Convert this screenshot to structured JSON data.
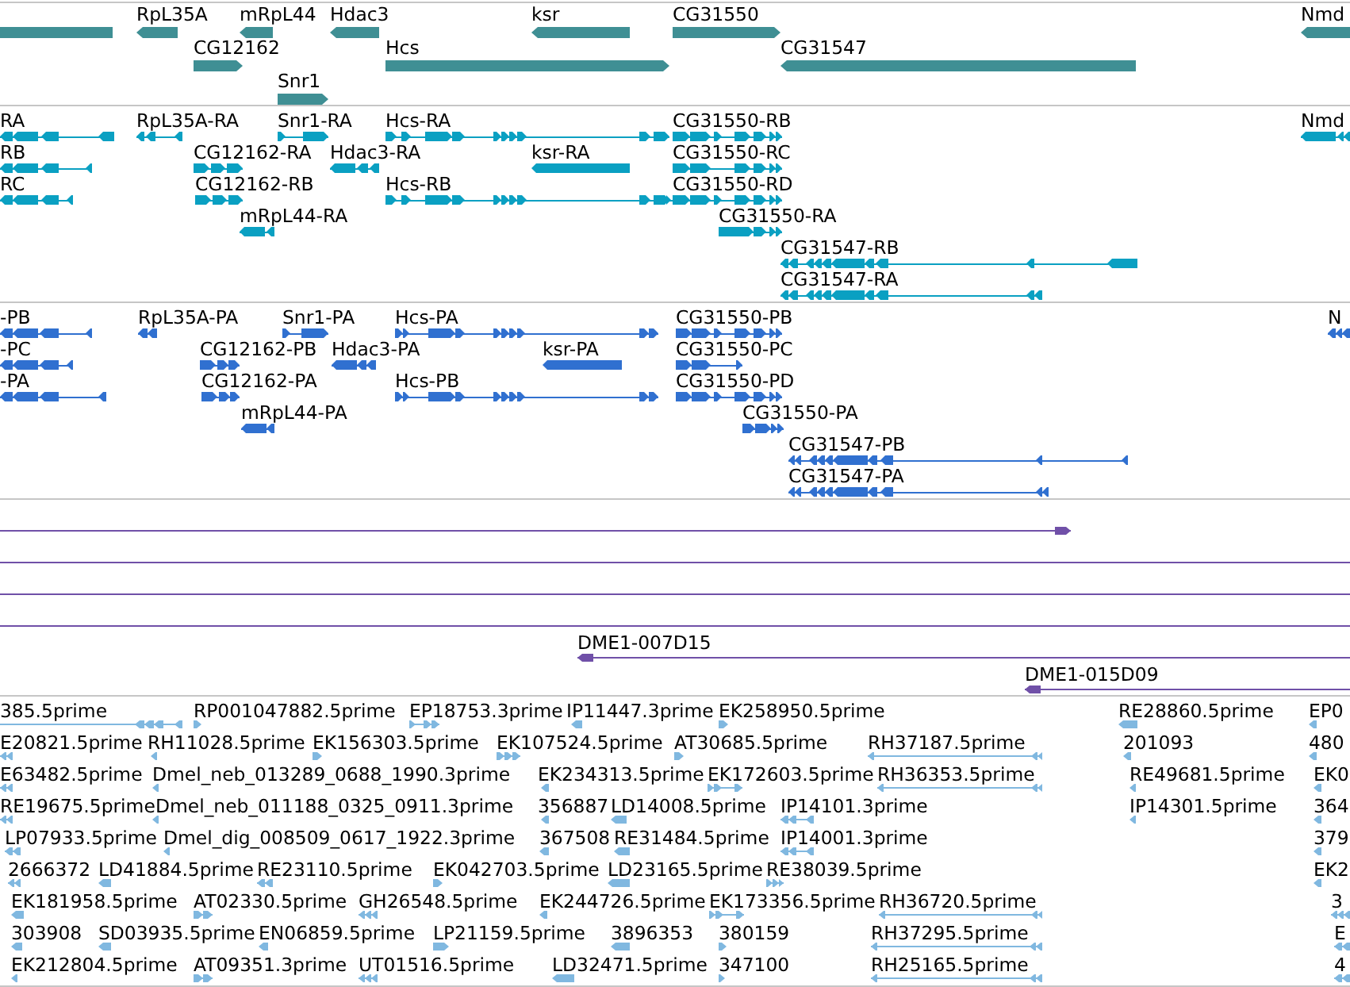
{
  "tracks": [
    {
      "kind": "gene",
      "features": [
        {
          "kind": "plain"
        },
        {
          "label": "RpL35A",
          "kind": "reverse"
        },
        {
          "label": "mRpL44",
          "kind": "reverse"
        },
        {
          "label": "Hdac3",
          "kind": "reverse"
        },
        {
          "label": "ksr",
          "kind": "reverse"
        },
        {
          "label": "CG31550",
          "kind": "forward"
        },
        {
          "label": "Nmd",
          "kind": "reverse"
        },
        {
          "label": "CG12162",
          "kind": "forward"
        },
        {
          "label": "Hcs",
          "kind": "forward"
        },
        {
          "label": "CG31547",
          "kind": "reverse"
        },
        {
          "label": "Snr1",
          "kind": "forward"
        }
      ]
    },
    {
      "kind": "transcript",
      "features": [
        {
          "label": "RA",
          "kind": "reverse"
        },
        {
          "label": "RpL35A-RA",
          "kind": "reverse"
        },
        {
          "label": "Snr1-RA",
          "kind": "forward"
        },
        {
          "label": "Hcs-RA",
          "kind": "forward"
        },
        {
          "label": "CG31550-RB",
          "kind": "forward"
        },
        {
          "label": "Nmd",
          "kind": "reverse"
        },
        {
          "label": "RB",
          "kind": "reverse"
        },
        {
          "label": "CG12162-RA",
          "kind": "forward"
        },
        {
          "label": "Hdac3-RA",
          "kind": "reverse"
        },
        {
          "label": "ksr-RA",
          "kind": "reverse"
        },
        {
          "label": "CG31550-RC",
          "kind": "forward"
        },
        {
          "label": "RC",
          "kind": "reverse"
        },
        {
          "label": "CG12162-RB",
          "kind": "forward"
        },
        {
          "label": "Hcs-RB",
          "kind": "forward"
        },
        {
          "label": "CG31550-RD",
          "kind": "forward"
        },
        {
          "label": "mRpL44-RA",
          "kind": "reverse"
        },
        {
          "label": "CG31550-RA",
          "kind": "forward"
        },
        {
          "label": "CG31547-RB",
          "kind": "reverse"
        },
        {
          "label": "CG31547-RA",
          "kind": "reverse"
        }
      ]
    },
    {
      "kind": "protein",
      "features": [
        {
          "label": "-PB",
          "kind": "reverse"
        },
        {
          "label": "RpL35A-PA",
          "kind": "reverse"
        },
        {
          "label": "Snr1-PA",
          "kind": "forward"
        },
        {
          "label": "Hcs-PA",
          "kind": "forward"
        },
        {
          "label": "CG31550-PB",
          "kind": "forward"
        },
        {
          "label": "N",
          "kind": "reverse"
        },
        {
          "label": "-PC",
          "kind": "reverse"
        },
        {
          "label": "CG12162-PB",
          "kind": "forward"
        },
        {
          "label": "Hdac3-PA",
          "kind": "reverse"
        },
        {
          "label": "ksr-PA",
          "kind": "reverse"
        },
        {
          "label": "CG31550-PC",
          "kind": "forward"
        },
        {
          "label": "-PA",
          "kind": "reverse"
        },
        {
          "label": "CG12162-PA",
          "kind": "forward"
        },
        {
          "label": "Hcs-PB",
          "kind": "forward"
        },
        {
          "label": "CG31550-PD",
          "kind": "forward"
        },
        {
          "label": "mRpL44-PA",
          "kind": "reverse"
        },
        {
          "label": "CG31550-PA",
          "kind": "forward"
        },
        {
          "label": "CG31547-PB",
          "kind": "reverse"
        },
        {
          "label": "CG31547-PA",
          "kind": "reverse"
        }
      ]
    },
    {
      "kind": "clone",
      "features": [
        {
          "kind": "forward"
        },
        {
          "kind": "plain"
        },
        {
          "kind": "plain"
        },
        {
          "kind": "plain"
        },
        {
          "label": "DME1-007D15",
          "kind": "reverse"
        },
        {
          "label": "DME1-015D09",
          "kind": "reverse"
        }
      ]
    },
    {
      "kind": "est",
      "features": [
        {
          "label": "385.5prime",
          "kind": "reverse"
        },
        {
          "label": "RP001047882.5prime",
          "kind": "forward"
        },
        {
          "label": "EP18753.3prime",
          "kind": "forward"
        },
        {
          "label": "IP11447.3prime",
          "kind": "reverse"
        },
        {
          "label": "EK258950.5prime",
          "kind": "forward"
        },
        {
          "label": "RE28860.5prime",
          "kind": "reverse"
        },
        {
          "label": "EP0",
          "kind": "reverse"
        },
        {
          "label": "E20821.5prime",
          "kind": "reverse"
        },
        {
          "label": "RH11028.5prime",
          "kind": "reverse"
        },
        {
          "label": "EK156303.5prime",
          "kind": "forward"
        },
        {
          "label": "EK107524.5prime",
          "kind": "forward"
        },
        {
          "label": "AT30685.5prime",
          "kind": "forward"
        },
        {
          "label": "RH37187.5prime",
          "kind": "reverse"
        },
        {
          "label": "201093",
          "kind": "reverse"
        },
        {
          "label": "480",
          "kind": "reverse"
        },
        {
          "label": "E63482.5prime",
          "kind": "reverse"
        },
        {
          "label": "Dmel_neb_013289_0688_1990.3prime",
          "kind": "reverse"
        },
        {
          "label": "EK234313.5prime",
          "kind": "reverse"
        },
        {
          "label": "EK172603.5prime",
          "kind": "forward"
        },
        {
          "label": "RH36353.5prime",
          "kind": "reverse"
        },
        {
          "label": "RE49681.5prime",
          "kind": "reverse"
        },
        {
          "label": "EK0",
          "kind": "reverse"
        },
        {
          "label": "RE19675.5prime",
          "kind": "reverse"
        },
        {
          "label": "Dmel_neb_011188_0325_0911.3prime",
          "kind": "reverse"
        },
        {
          "label": "356887",
          "kind": "reverse"
        },
        {
          "label": "LD14008.5prime",
          "kind": "reverse"
        },
        {
          "label": "IP14101.3prime",
          "kind": "reverse"
        },
        {
          "label": "IP14301.5prime",
          "kind": "reverse"
        },
        {
          "label": "364",
          "kind": "reverse"
        },
        {
          "label": "LP07933.5prime",
          "kind": "reverse"
        },
        {
          "label": "Dmel_dig_008509_0617_1922.3prime",
          "kind": "reverse"
        },
        {
          "label": "367508",
          "kind": "reverse"
        },
        {
          "label": "RE31484.5prime",
          "kind": "reverse"
        },
        {
          "label": "IP14001.3prime",
          "kind": "reverse"
        },
        {
          "label": "379",
          "kind": "reverse"
        },
        {
          "label": "2666372",
          "kind": "reverse"
        },
        {
          "label": "LD41884.5prime",
          "kind": "reverse"
        },
        {
          "label": "RE23110.5prime",
          "kind": "reverse"
        },
        {
          "label": "EK042703.5prime",
          "kind": "forward"
        },
        {
          "label": "LD23165.5prime",
          "kind": "reverse"
        },
        {
          "label": "RE38039.5prime",
          "kind": "forward"
        },
        {
          "label": "EK2",
          "kind": "reverse"
        },
        {
          "label": "EK181958.5prime",
          "kind": "reverse"
        },
        {
          "label": "AT02330.5prime",
          "kind": "forward"
        },
        {
          "label": "GH26548.5prime",
          "kind": "reverse"
        },
        {
          "label": "EK244726.5prime",
          "kind": "reverse"
        },
        {
          "label": "EK173356.5prime",
          "kind": "forward"
        },
        {
          "label": "RH36720.5prime",
          "kind": "reverse"
        },
        {
          "label": "3",
          "kind": "reverse"
        },
        {
          "label": "303908",
          "kind": "reverse"
        },
        {
          "label": "SD03935.5prime",
          "kind": "reverse"
        },
        {
          "label": "EN06859.5prime",
          "kind": "reverse"
        },
        {
          "label": "LP21159.5prime",
          "kind": "forward"
        },
        {
          "label": "3896353",
          "kind": "reverse"
        },
        {
          "label": "380159",
          "kind": "forward"
        },
        {
          "label": "RH37295.5prime",
          "kind": "reverse"
        },
        {
          "label": "E",
          "kind": "reverse"
        },
        {
          "label": "EK212804.5prime",
          "kind": "reverse"
        },
        {
          "label": "AT09351.3prime",
          "kind": "forward"
        },
        {
          "label": "UT01516.5prime",
          "kind": "reverse"
        },
        {
          "label": "LD32471.5prime",
          "kind": "reverse"
        },
        {
          "label": "347100",
          "kind": "forward"
        },
        {
          "label": "RH25165.5prime",
          "kind": "reverse"
        },
        {
          "label": "4",
          "kind": "reverse"
        }
      ]
    }
  ]
}
